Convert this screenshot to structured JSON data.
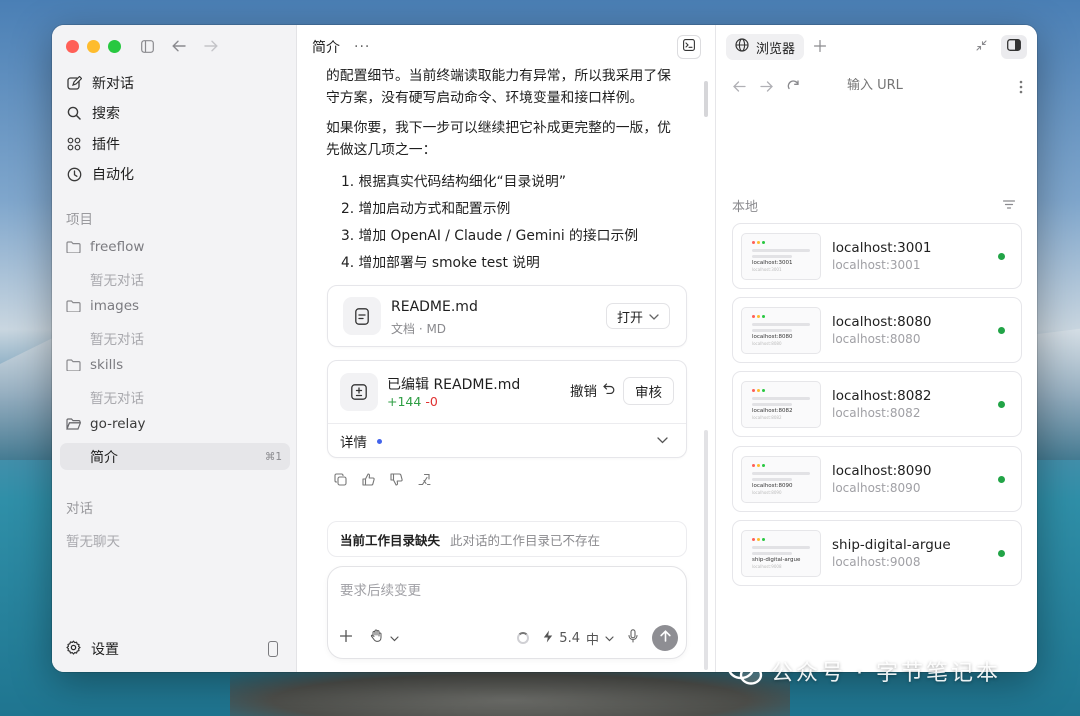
{
  "sidebar": {
    "nav": [
      {
        "label": "新对话",
        "icon": "edit-icon"
      },
      {
        "label": "搜索",
        "icon": "search-icon"
      },
      {
        "label": "插件",
        "icon": "plugins-icon"
      },
      {
        "label": "自动化",
        "icon": "clock-icon"
      }
    ],
    "projects_label": "项目",
    "projects": [
      {
        "name": "freeflow",
        "empty": "暂无对话"
      },
      {
        "name": "images",
        "empty": "暂无对话"
      },
      {
        "name": "skills",
        "empty": "暂无对话"
      },
      {
        "name": "go-relay"
      }
    ],
    "active_item": {
      "label": "简介",
      "shortcut": "⌘1"
    },
    "chats_label": "对话",
    "chats_empty": "暂无聊天",
    "settings_label": "设置"
  },
  "chat": {
    "title": "简介",
    "more": "···",
    "paragraphs": [
      "的配置细节。当前终端读取能力有异常，所以我采用了保守方案，没有硬写启动命令、环境变量和接口样例。",
      "如果你要，我下一步可以继续把它补成更完整的一版，优先做这几项之一："
    ],
    "list": [
      "1. 根据真实代码结构细化“目录说明”",
      "2. 增加启动方式和配置示例",
      "3. 增加 OpenAI / Claude / Gemini 的接口示例",
      "4. 增加部署与 smoke test 说明"
    ],
    "file_card": {
      "name": "README.md",
      "meta": "文档 · MD",
      "open_label": "打开"
    },
    "edit_card": {
      "title": "已编辑 README.md",
      "additions": "+144",
      "deletions": "-0",
      "undo_label": "撤销",
      "review_label": "审核",
      "details_label": "详情"
    },
    "warning": {
      "title": "当前工作目录缺失",
      "desc": "此对话的工作目录已不存在"
    },
    "composer": {
      "placeholder": "要求后续变更",
      "model": "5.4",
      "effort": "中"
    }
  },
  "browser": {
    "tab_label": "浏览器",
    "url_placeholder": "输入 URL",
    "local_label": "本地",
    "sites": [
      {
        "title": "localhost:3001",
        "sub": "localhost:3001"
      },
      {
        "title": "localhost:8080",
        "sub": "localhost:8080"
      },
      {
        "title": "localhost:8082",
        "sub": "localhost:8082"
      },
      {
        "title": "localhost:8090",
        "sub": "localhost:8090"
      },
      {
        "title": "ship-digital-argue",
        "sub": "localhost:9008"
      }
    ],
    "status_color": "#22a447"
  },
  "watermark": {
    "text": "公众号 · 字节笔记本"
  }
}
